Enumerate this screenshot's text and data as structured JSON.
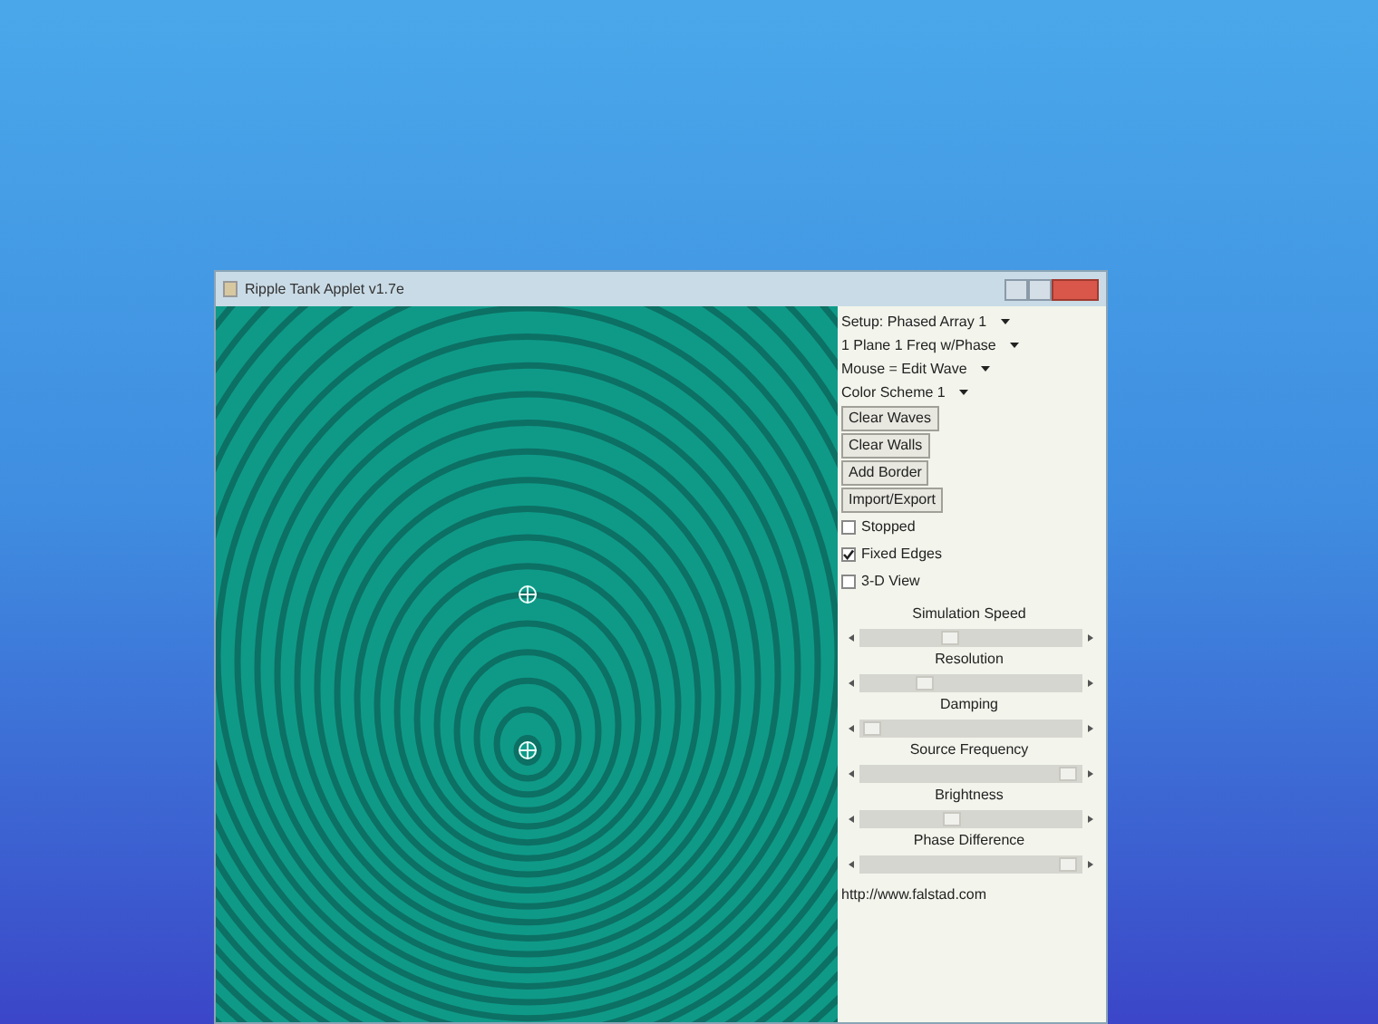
{
  "window": {
    "title": "Ripple Tank Applet v1.7e"
  },
  "dropdowns": [
    "Setup: Phased Array 1",
    "1 Plane 1 Freq w/Phase",
    "Mouse = Edit Wave",
    "Color Scheme 1"
  ],
  "buttons": [
    "Clear Waves",
    "Clear Walls",
    "Add Border",
    "Import/Export"
  ],
  "checkboxes": [
    {
      "label": "Stopped",
      "checked": false
    },
    {
      "label": "Fixed Edges",
      "checked": true
    },
    {
      "label": "3-D View",
      "checked": false
    }
  ],
  "sliders": [
    {
      "label": "Simulation Speed",
      "level": 0.4
    },
    {
      "label": "Resolution",
      "level": 0.27
    },
    {
      "label": "Damping",
      "level": 0.02
    },
    {
      "label": "Source Frequency",
      "level": 0.97
    },
    {
      "label": "Brightness",
      "level": 0.41
    },
    {
      "label": "Phase Difference",
      "level": 0.97
    }
  ],
  "link": "http://www.falstad.com"
}
